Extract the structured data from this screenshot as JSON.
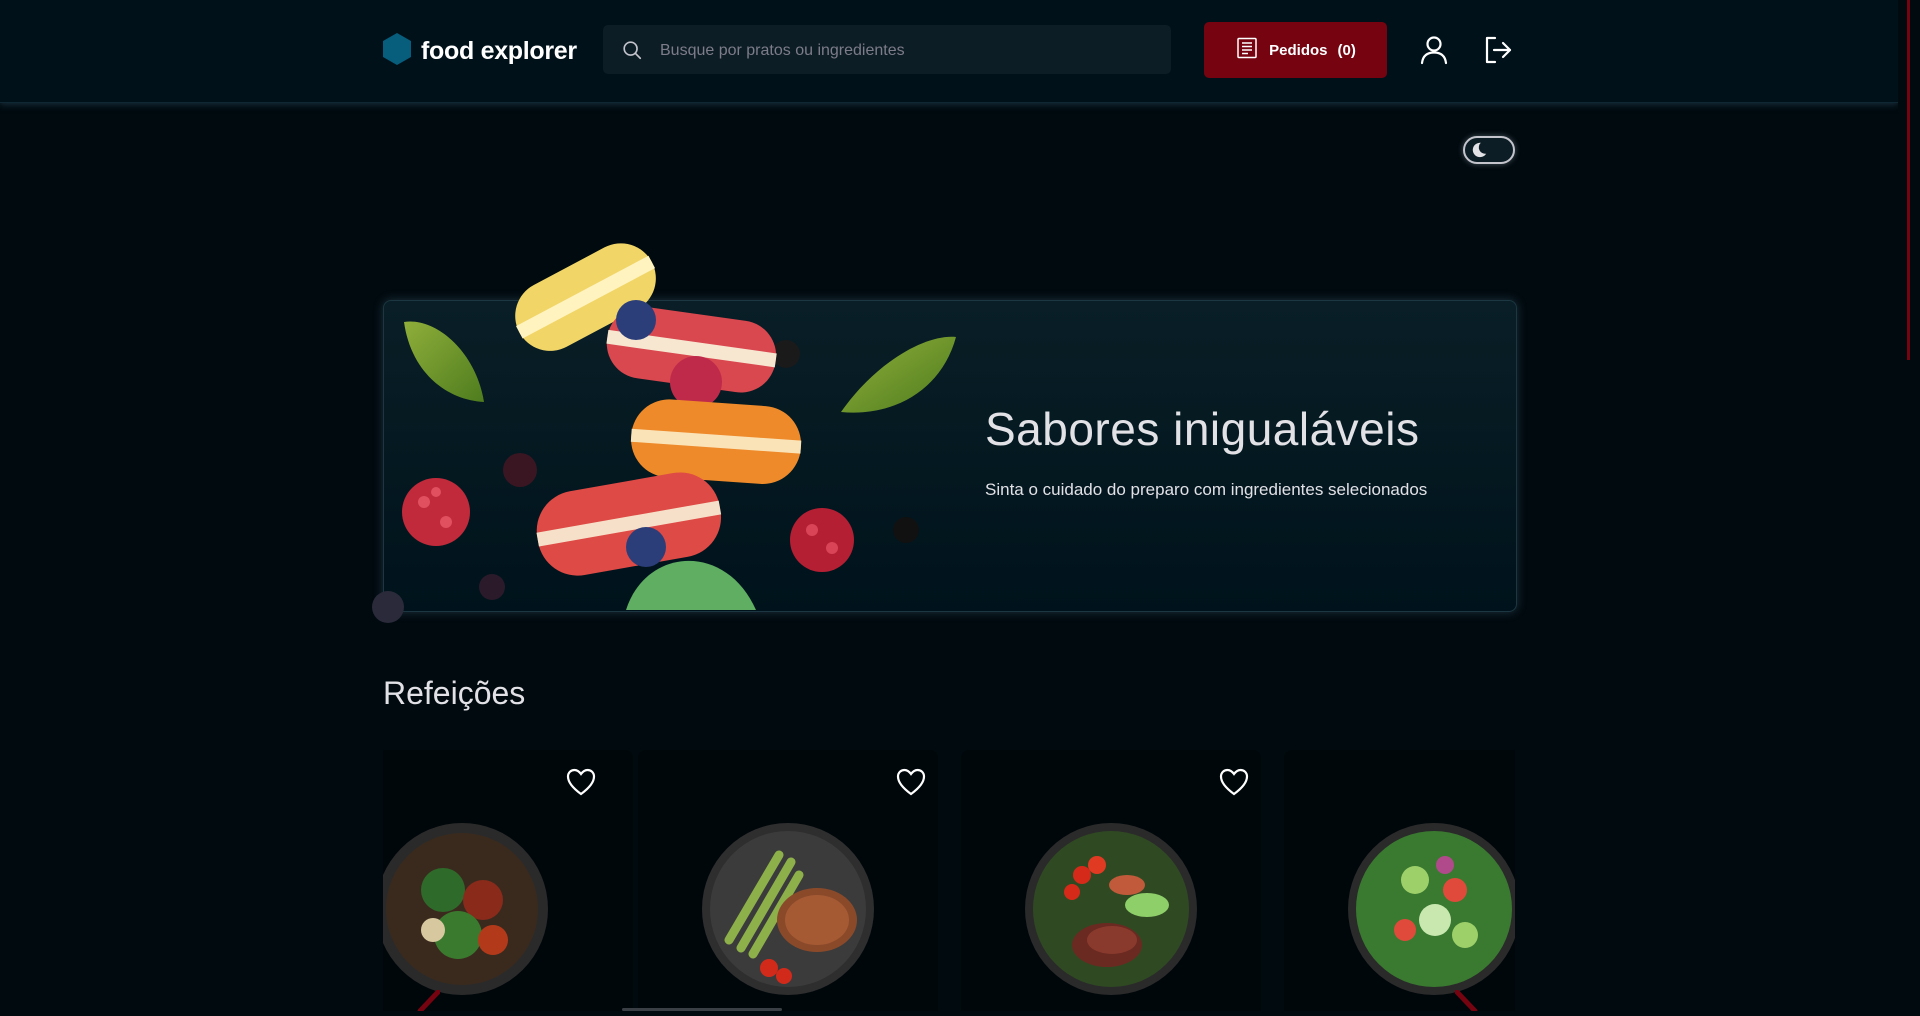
{
  "app": {
    "logo_text": "food explorer",
    "logo_color": "#065e7c"
  },
  "header": {
    "search_placeholder": "Busque por pratos ou ingredientes",
    "orders_label": "Pedidos",
    "orders_count": "(0)",
    "orders_color": "#750310",
    "icons": [
      "search-icon",
      "receipt-icon",
      "user-icon",
      "sign-out-icon"
    ]
  },
  "theme_toggle": {
    "icon": "moon-icon",
    "state": "dark"
  },
  "banner": {
    "title": "Sabores inigualáveis",
    "subtitle": "Sinta o cuidado do preparo com ingredientes selecionados"
  },
  "sections": [
    {
      "title": "Refeições",
      "cards": [
        {
          "image": "salad-dish-image",
          "icon": "heart-icon"
        },
        {
          "image": "steak-asparagus-dish-image",
          "icon": "heart-icon"
        },
        {
          "image": "meat-salad-dish-image",
          "icon": "heart-icon"
        },
        {
          "image": "green-salad-dish-image",
          "icon": "heart-icon"
        }
      ]
    }
  ],
  "colors": {
    "background": "#000a0f",
    "header": "#00111a",
    "accent": "#750310",
    "text": "#e1e1e6"
  }
}
